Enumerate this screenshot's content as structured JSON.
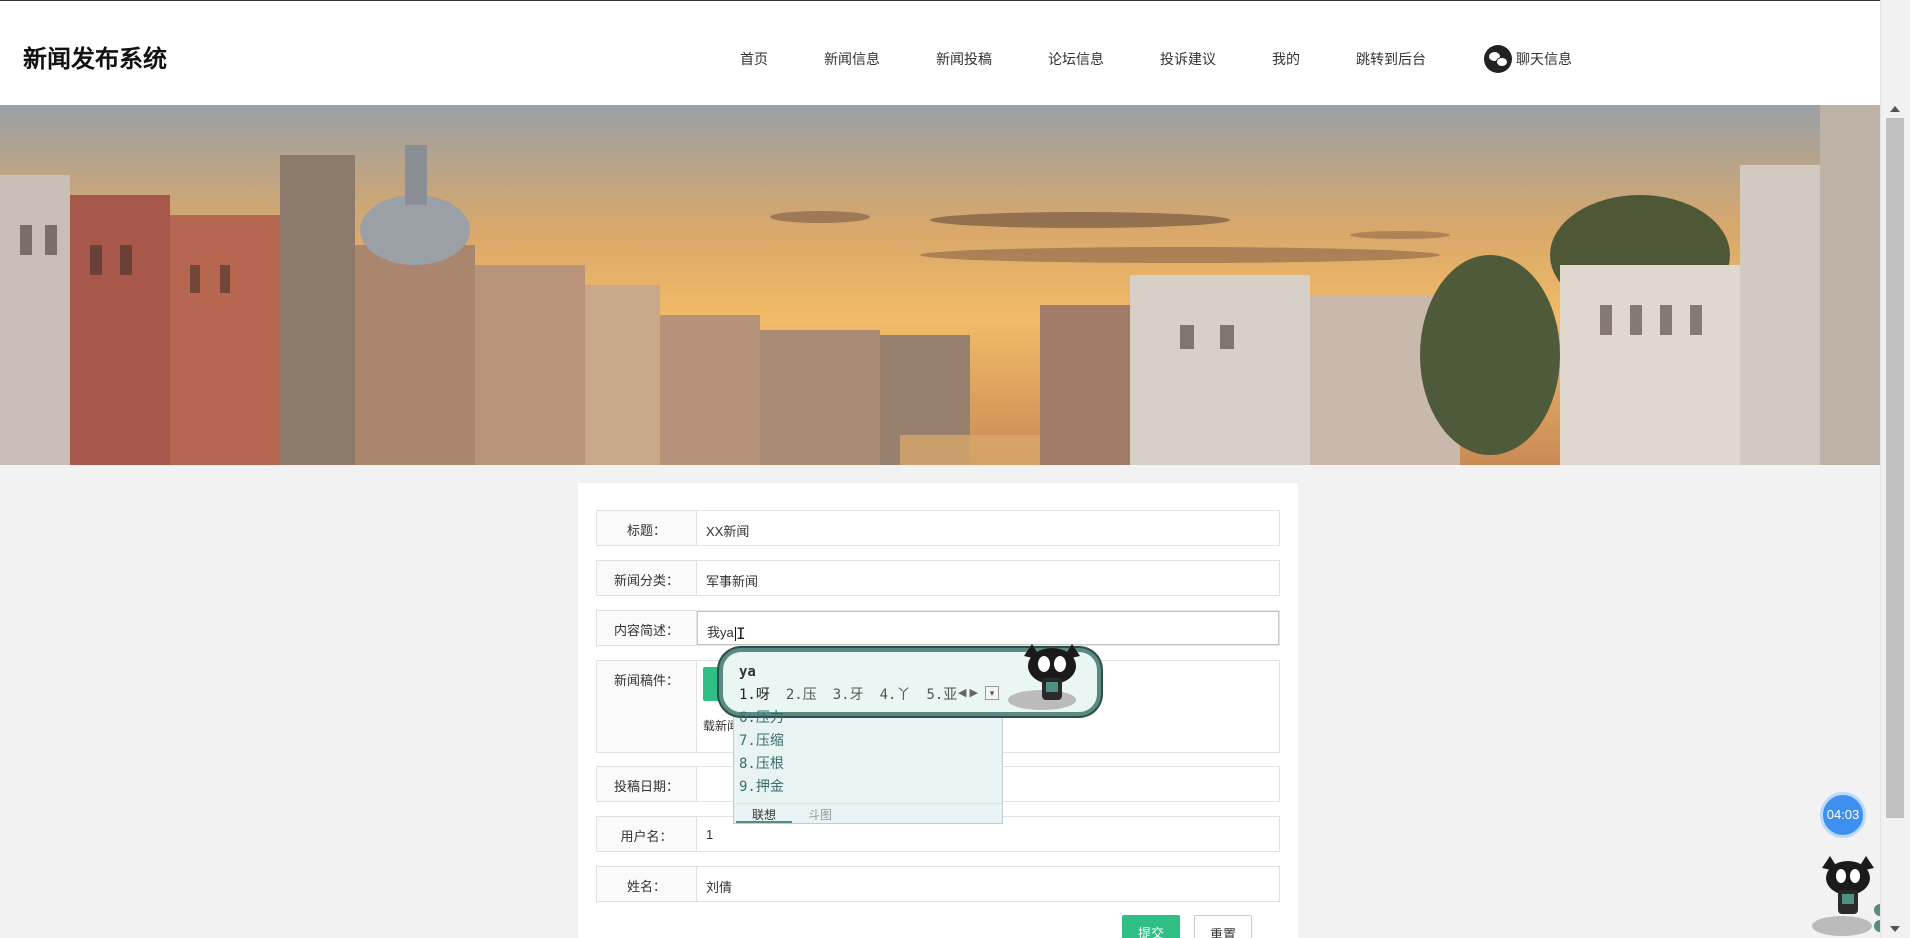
{
  "header": {
    "logo": "新闻发布系统",
    "nav": [
      {
        "label": "首页"
      },
      {
        "label": "新闻信息"
      },
      {
        "label": "新闻投稿"
      },
      {
        "label": "论坛信息"
      },
      {
        "label": "投诉建议"
      },
      {
        "label": "我的"
      },
      {
        "label": "跳转到后台"
      }
    ],
    "chat_label": "聊天信息",
    "chat_icon": "wechat-icon"
  },
  "form": {
    "title": {
      "label": "标题：",
      "value": "XX新闻"
    },
    "category": {
      "label": "新闻分类：",
      "value": "军事新闻"
    },
    "summary": {
      "label": "内容简述：",
      "value": "我ya"
    },
    "manuscript": {
      "label": "新闻稿件：",
      "hint": "载新闻"
    },
    "date": {
      "label": "投稿日期：",
      "value": ""
    },
    "username": {
      "label": "用户名：",
      "value": "1"
    },
    "name": {
      "label": "姓名：",
      "value": "刘倩"
    },
    "submit_label": "提交",
    "reset_label": "重置"
  },
  "ime": {
    "pinyin": "ya",
    "candidates": [
      "1.呀",
      "2.压",
      "3.牙",
      "4.丫",
      "5.亚"
    ],
    "more": [
      "6.压力",
      "7.压缩",
      "8.压根",
      "9.押金"
    ],
    "tabs": [
      "联想",
      "斗图"
    ]
  },
  "timer": "04:03",
  "colors": {
    "accent": "#2fbf84",
    "timer": "#3d8ff0",
    "ime_border": "#5a8a84"
  }
}
